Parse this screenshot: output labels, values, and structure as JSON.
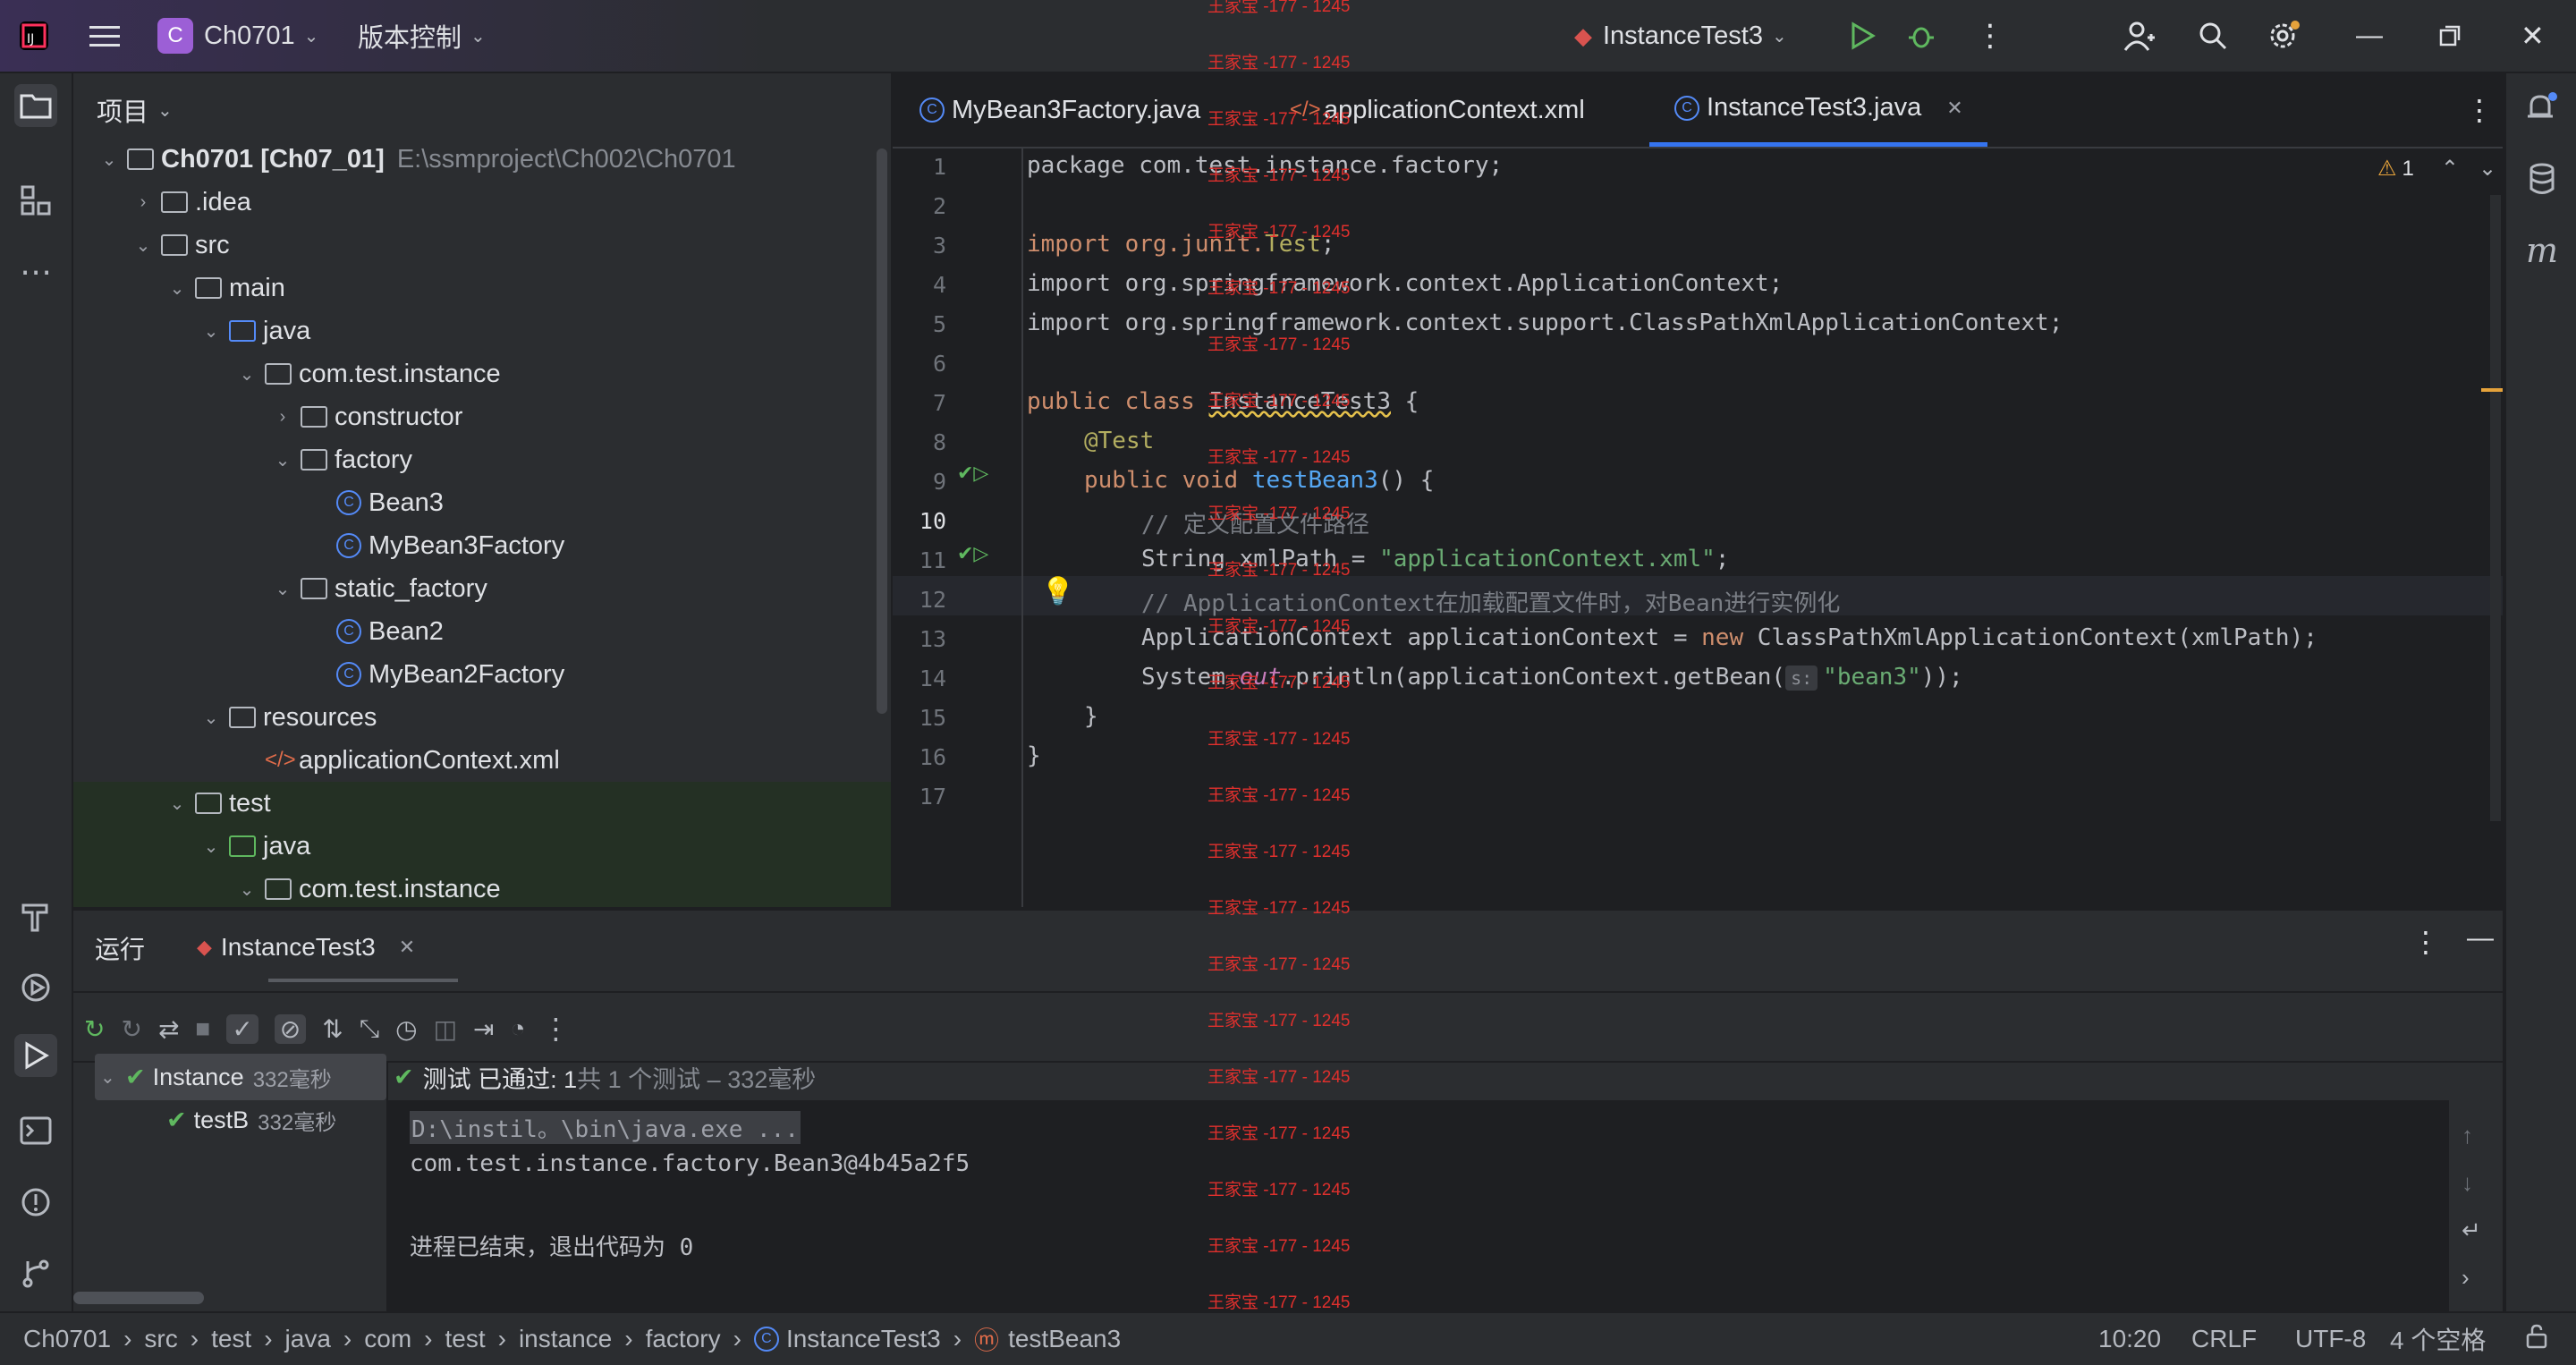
{
  "titlebar": {
    "project_badge": "C",
    "project_name": "Ch0701",
    "vcs_label": "版本控制",
    "run_config": "InstanceTest3"
  },
  "project_panel": {
    "title": "项目",
    "tree": [
      {
        "label": "Ch0701 [Ch07_01]",
        "extra": "E:\\ssmproject\\Ch002\\Ch0701",
        "icon": "module-folder-icon",
        "arrow": "expanded"
      },
      {
        "label": ".idea",
        "icon": "folder-icon",
        "arrow": "collapsed"
      },
      {
        "label": "src",
        "icon": "folder-icon",
        "arrow": "expanded"
      },
      {
        "label": "main",
        "icon": "folder-icon",
        "arrow": "expanded"
      },
      {
        "label": "java",
        "icon": "source-folder-icon",
        "arrow": "expanded"
      },
      {
        "label": "com.test.instance",
        "icon": "package-icon",
        "arrow": "expanded"
      },
      {
        "label": "constructor",
        "icon": "package-icon",
        "arrow": "collapsed"
      },
      {
        "label": "factory",
        "icon": "package-icon",
        "arrow": "expanded"
      },
      {
        "label": "Bean3",
        "icon": "class-icon",
        "arrow": "none"
      },
      {
        "label": "MyBean3Factory",
        "icon": "class-icon",
        "arrow": "none"
      },
      {
        "label": "static_factory",
        "icon": "package-icon",
        "arrow": "expanded"
      },
      {
        "label": "Bean2",
        "icon": "class-icon",
        "arrow": "none"
      },
      {
        "label": "MyBean2Factory",
        "icon": "class-icon",
        "arrow": "none"
      },
      {
        "label": "resources",
        "icon": "resources-folder-icon",
        "arrow": "expanded"
      },
      {
        "label": "applicationContext.xml",
        "icon": "xml-file-icon",
        "arrow": "none"
      },
      {
        "label": "test",
        "icon": "folder-icon",
        "arrow": "expanded"
      },
      {
        "label": "java",
        "icon": "test-folder-icon",
        "arrow": "expanded"
      },
      {
        "label": "com.test.instance",
        "icon": "package-icon",
        "arrow": "expanded"
      }
    ]
  },
  "editor": {
    "tabs": [
      {
        "label": "MyBean3Factory.java",
        "icon": "class-icon"
      },
      {
        "label": "applicationContext.xml",
        "icon": "xml-file-icon"
      },
      {
        "label": "InstanceTest3.java",
        "icon": "class-icon"
      }
    ],
    "warning_count": "1",
    "line_numbers": [
      "1",
      "2",
      "3",
      "4",
      "5",
      "6",
      "7",
      "8",
      "9",
      "10",
      "11",
      "12",
      "13",
      "14",
      "15",
      "16",
      "17"
    ],
    "code": {
      "l1": "package com.test.instance.factory;",
      "l3a": "import org.junit.",
      "l3b": "Test",
      "l3c": ";",
      "l4": "import org.springframework.context.ApplicationContext;",
      "l5": "import org.springframework.context.support.ClassPathXmlApplicationContext;",
      "l7a": "public class ",
      "l7b": "InstanceTest3",
      "l7c": " {",
      "l8": "@Test",
      "l9a": "public void ",
      "l9b": "testBean3",
      "l9c": "() {",
      "l10": "// 定义配置文件路径",
      "l11a": "String xmlPath = ",
      "l11b": "\"applicationContext.xml\"",
      "l11c": ";",
      "l12": "// ApplicationContext在加载配置文件时，对Bean进行实例化",
      "l13a": "ApplicationContext applicationContext = ",
      "l13b": "new",
      "l13c": " ClassPathXmlApplicationContext(xmlPath);",
      "l14a": "System.",
      "l14b": "out",
      "l14c": ".println(applicationContext.getBean(",
      "l14hint": "s:",
      "l14d": "\"bean3\"",
      "l14e": "));",
      "l15": "}",
      "l16": "}"
    }
  },
  "run_panel": {
    "tab_run": "运行",
    "tab_config": "InstanceTest3",
    "tree": [
      {
        "label": "Instance",
        "time": "332毫秒"
      },
      {
        "label": "testB",
        "time": "332毫秒"
      }
    ],
    "summary_a": "测试 已通过: 1",
    "summary_b": "共 1 个测试 – 332毫秒",
    "console": [
      "D:\\instil。\\bin\\java.exe ...",
      "com.test.instance.factory.Bean3@4b45a2f5",
      "",
      "进程已结束，退出代码为 0"
    ]
  },
  "statusbar": {
    "breadcrumbs": [
      "Ch0701",
      "src",
      "test",
      "java",
      "com",
      "test",
      "instance",
      "factory",
      "InstanceTest3",
      "testBean3"
    ],
    "position": "10:20",
    "line_sep": "CRLF",
    "encoding": "UTF-8",
    "indent": "4 个空格"
  },
  "watermark": "王家宝 -177 - 1245",
  "colors": {
    "accent": "#3574f0",
    "keyword": "#cf8e6d",
    "string": "#6aab73",
    "comment": "#7a7e85",
    "pass_green": "#5fb85f",
    "watermark_red": "#e0302d"
  }
}
